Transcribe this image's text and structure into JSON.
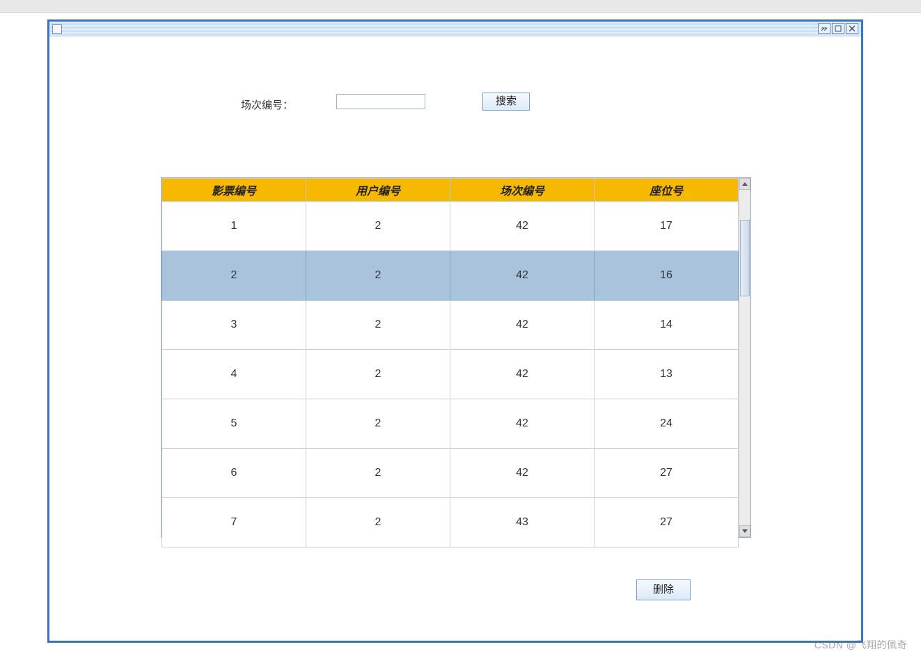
{
  "window": {
    "title": ""
  },
  "search": {
    "label": "场次编号：",
    "value": "",
    "button": "搜索"
  },
  "table": {
    "headers": [
      "影票编号",
      "用户编号",
      "场次编号",
      "座位号"
    ],
    "selected_index": 1,
    "rows": [
      {
        "ticket_id": "1",
        "user_id": "2",
        "session_id": "42",
        "seat": "17"
      },
      {
        "ticket_id": "2",
        "user_id": "2",
        "session_id": "42",
        "seat": "16"
      },
      {
        "ticket_id": "3",
        "user_id": "2",
        "session_id": "42",
        "seat": "14"
      },
      {
        "ticket_id": "4",
        "user_id": "2",
        "session_id": "42",
        "seat": "13"
      },
      {
        "ticket_id": "5",
        "user_id": "2",
        "session_id": "42",
        "seat": "24"
      },
      {
        "ticket_id": "6",
        "user_id": "2",
        "session_id": "42",
        "seat": "27"
      },
      {
        "ticket_id": "7",
        "user_id": "2",
        "session_id": "43",
        "seat": "27"
      }
    ]
  },
  "actions": {
    "delete": "删除"
  },
  "watermark": "CSDN @飞翔的佩奇"
}
